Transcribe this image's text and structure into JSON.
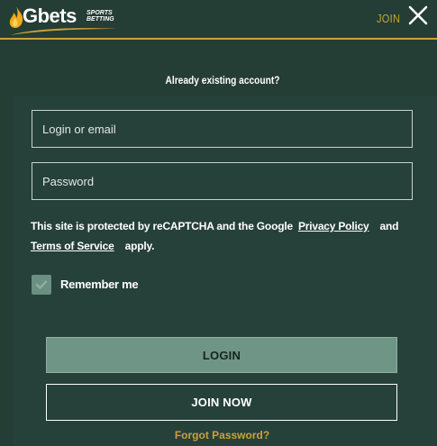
{
  "header": {
    "logo_text": "Gbets",
    "logo_sub_1": "SPORTS",
    "logo_sub_2": "BETTING",
    "join_label": "JOIN",
    "close_icon": "close-icon"
  },
  "form": {
    "heading": "Already existing account?",
    "login_placeholder": "Login or email",
    "login_value": "",
    "password_placeholder": "Password",
    "password_value": "",
    "recaptcha_text_1": "This site is protected by reCAPTCHA and the Google",
    "privacy_link": "Privacy Policy",
    "and_text": "and",
    "terms_link": "Terms of Service",
    "apply_text": "apply.",
    "remember_label": "Remember me",
    "remember_checked": true,
    "login_button": "LOGIN",
    "join_button": "JOIN NOW",
    "forgot_link": "Forgot Password?"
  },
  "colors": {
    "background": "#243d35",
    "panel": "#26403a",
    "accent_gold": "#c9a23a",
    "login_button_bg": "#6e9585",
    "checkbox_bg": "#6b8f81"
  }
}
